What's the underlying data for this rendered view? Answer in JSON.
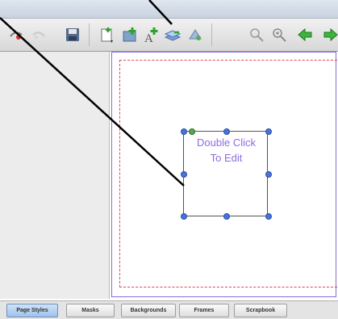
{
  "toolbar": {
    "buttons": [
      {
        "name": "undo-icon"
      },
      {
        "name": "redo-icon"
      },
      {
        "name": "save-icon"
      },
      {
        "name": "new-page-icon"
      },
      {
        "name": "add-image-icon"
      },
      {
        "name": "add-text-icon"
      },
      {
        "name": "add-layer-icon"
      },
      {
        "name": "paint-icon"
      },
      {
        "name": "zoom-out-icon"
      },
      {
        "name": "zoom-in-icon"
      },
      {
        "name": "previous-page-icon"
      },
      {
        "name": "next-page-icon"
      }
    ]
  },
  "canvas": {
    "textbox": {
      "line1": "Double Click",
      "line2": "To Edit"
    }
  },
  "tabs": [
    {
      "label": "Page Styles",
      "active": true
    },
    {
      "label": "Masks"
    },
    {
      "label": "Backgrounds"
    },
    {
      "label": "Frames"
    },
    {
      "label": "Scrapbook"
    }
  ],
  "colors": {
    "page_outline": "#8a6bdc",
    "margin_guide": "#e0455c",
    "textbox_text": "#8e6ce3",
    "handles": "#4a72d8"
  }
}
